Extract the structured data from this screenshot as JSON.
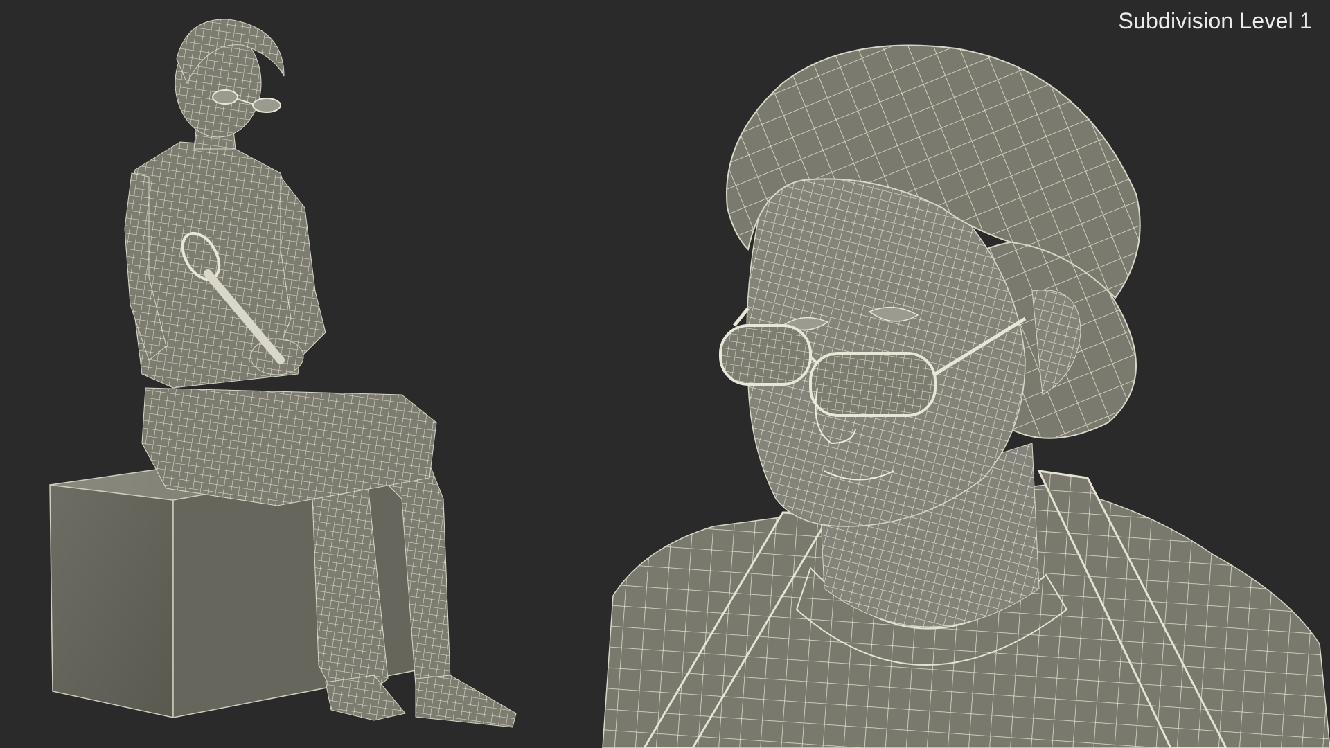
{
  "overlay": {
    "subdivision_label": "Subdivision Level 1"
  },
  "scene": {
    "background_color": "#2a2a2a",
    "mesh_fill_color": "#807f73",
    "wire_color": "#e8e6d6",
    "views": [
      {
        "name": "full-body-view",
        "subject": "seated elderly woman with glasses holding whisk on box"
      },
      {
        "name": "closeup-view",
        "subject": "head and shoulders close-up"
      }
    ]
  }
}
